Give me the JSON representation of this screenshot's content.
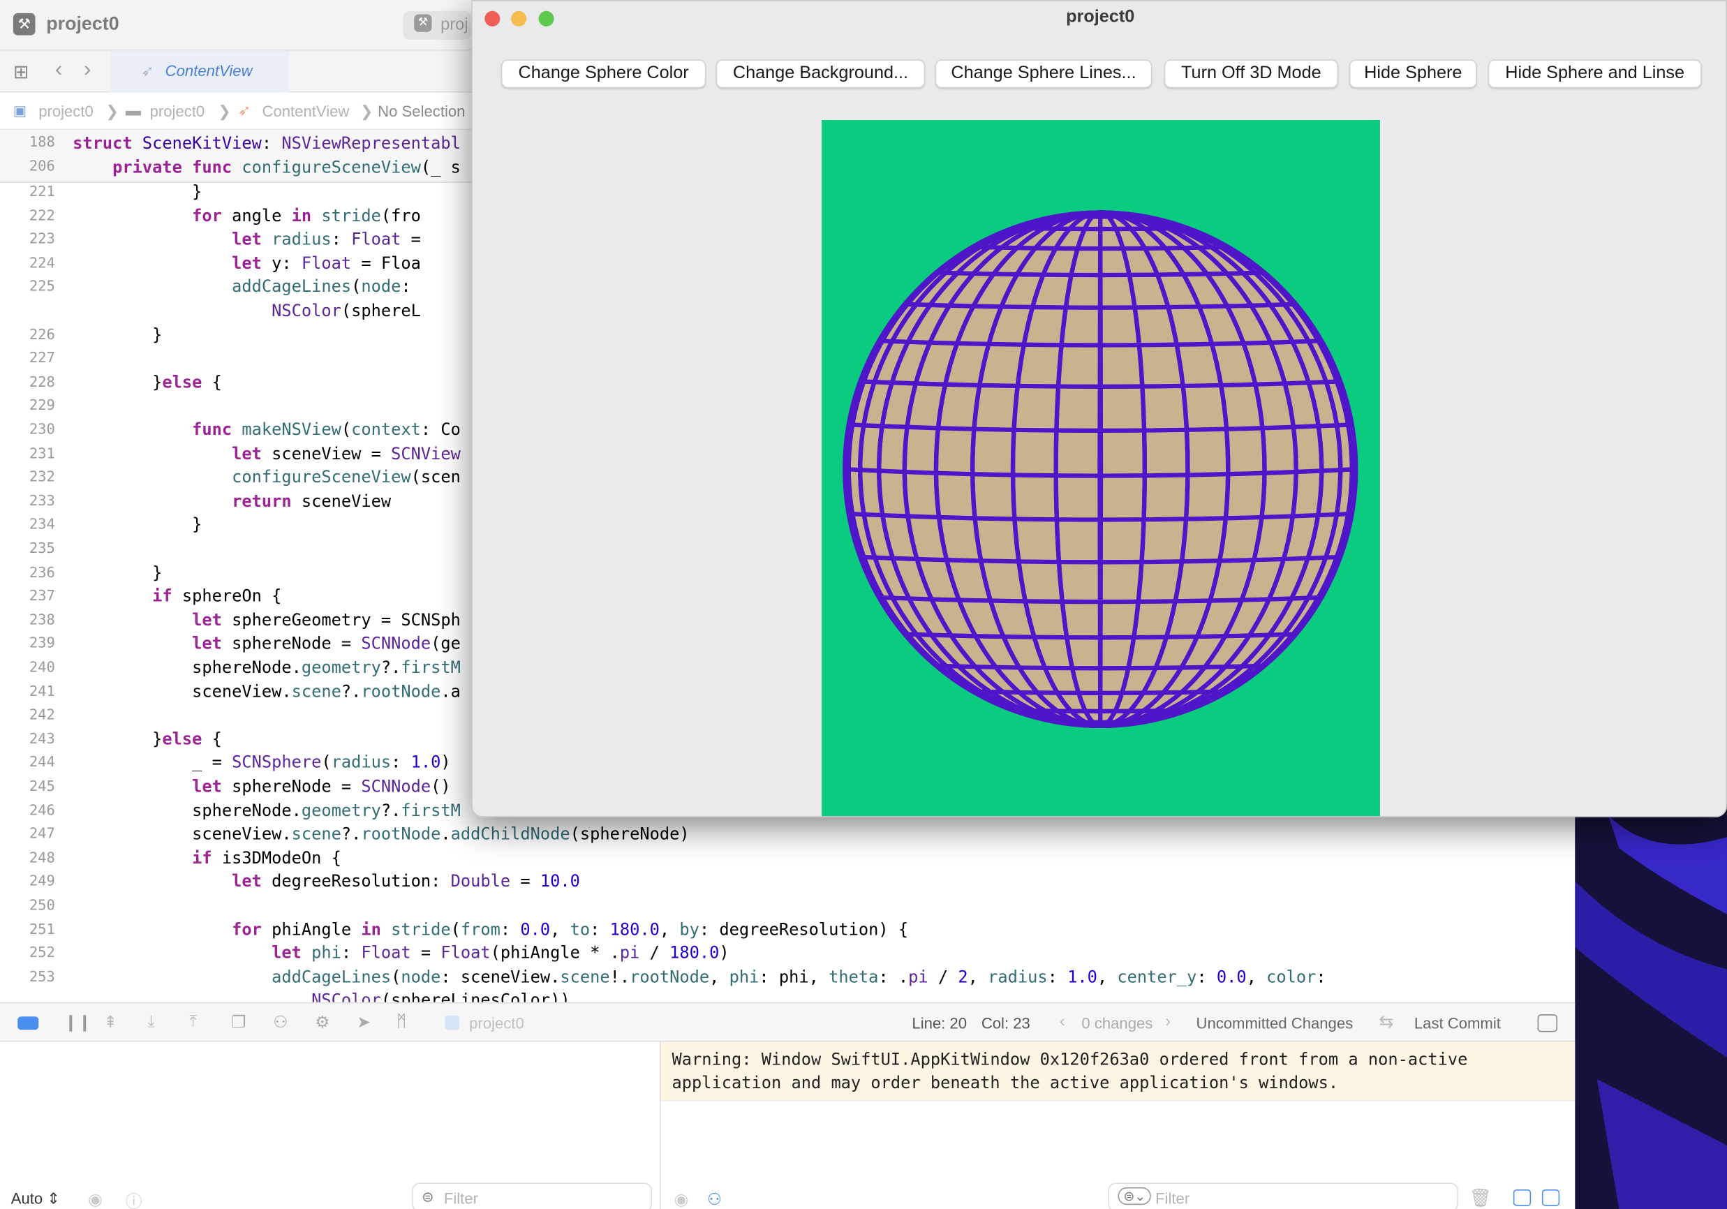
{
  "xcode": {
    "project_title": "project0",
    "second_tab_title": "proj",
    "editor_tab": "ContentView",
    "breadcrumb": [
      "project0",
      "project0",
      "ContentView",
      "No Selection"
    ],
    "sticky_lines": [
      {
        "num": "188",
        "text": "struct SceneKitView: NSViewRepresentabl"
      },
      {
        "num": "206",
        "text": "    private func configureSceneView(_ s"
      }
    ],
    "code_lines": [
      {
        "num": "221",
        "text": "            }"
      },
      {
        "num": "222",
        "text": "            for angle in stride(fro"
      },
      {
        "num": "223",
        "text": "                let radius: Float ="
      },
      {
        "num": "224",
        "text": "                let y: Float = Floa"
      },
      {
        "num": "225",
        "text": "                addCageLines(node:"
      },
      {
        "num": "",
        "text": "                    NSColor(sphereL"
      },
      {
        "num": "226",
        "text": "        }"
      },
      {
        "num": "227",
        "text": ""
      },
      {
        "num": "228",
        "text": "        }else {"
      },
      {
        "num": "229",
        "text": ""
      },
      {
        "num": "230",
        "text": "            func makeNSView(context: Co"
      },
      {
        "num": "231",
        "text": "                let sceneView = SCNView"
      },
      {
        "num": "232",
        "text": "                configureSceneView(scen"
      },
      {
        "num": "233",
        "text": "                return sceneView"
      },
      {
        "num": "234",
        "text": "            }"
      },
      {
        "num": "235",
        "text": ""
      },
      {
        "num": "236",
        "text": "        }"
      },
      {
        "num": "237",
        "text": "        if sphereOn {"
      },
      {
        "num": "238",
        "text": "            let sphereGeometry = SCNSph"
      },
      {
        "num": "239",
        "text": "            let sphereNode = SCNNode(ge"
      },
      {
        "num": "240",
        "text": "            sphereNode.geometry?.firstM"
      },
      {
        "num": "241",
        "text": "            sceneView.scene?.rootNode.a"
      },
      {
        "num": "242",
        "text": ""
      },
      {
        "num": "243",
        "text": "        }else {"
      },
      {
        "num": "244",
        "text": "            _ = SCNSphere(radius: 1.0)"
      },
      {
        "num": "245",
        "text": "            let sphereNode = SCNNode()"
      },
      {
        "num": "246",
        "text": "            sphereNode.geometry?.firstM"
      },
      {
        "num": "247",
        "text": "            sceneView.scene?.rootNode.addChildNode(sphereNode)"
      },
      {
        "num": "248",
        "text": "            if is3DModeOn {"
      },
      {
        "num": "249",
        "text": "                let degreeResolution: Double = 10.0"
      },
      {
        "num": "250",
        "text": ""
      },
      {
        "num": "251",
        "text": "                for phiAngle in stride(from: 0.0, to: 180.0, by: degreeResolution) {"
      },
      {
        "num": "252",
        "text": "                    let phi: Float = Float(phiAngle * .pi / 180.0)"
      },
      {
        "num": "253",
        "text": "                    addCageLines(node: sceneView.scene!.rootNode, phi: phi, theta: .pi / 2, radius: 1.0, center_y: 0.0, color:"
      },
      {
        "num": "",
        "text": "                        NSColor(sphereLinesColor))"
      }
    ],
    "debug_bar": {
      "target": "project0",
      "line": "Line: 20",
      "col": "Col: 23",
      "changes": "0 changes",
      "uncommitted": "Uncommitted Changes",
      "last_commit": "Last Commit"
    },
    "console": {
      "warning": "Warning: Window SwiftUI.AppKitWindow 0x120f263a0 ordered front from a non-active\napplication and may order beneath the active application's windows.",
      "auto_label": "Auto",
      "filter_placeholder_left": "Filter",
      "filter_placeholder_right": "Filter"
    }
  },
  "app": {
    "title": "project0",
    "buttons": [
      "Change Sphere Color",
      "Change Background...",
      "Change Sphere Lines...",
      "Turn Off 3D Mode",
      "Hide Sphere",
      "Hide Sphere and Linse"
    ],
    "scene": {
      "background_color": "#0acb80",
      "sphere_color": "#cbb28f",
      "lines_color": "#4e16c8"
    }
  },
  "colors": {
    "accent": "#4a7fd6",
    "close": "#ee5f57",
    "minimize": "#f5bd4f",
    "zoom": "#5fc94f"
  }
}
